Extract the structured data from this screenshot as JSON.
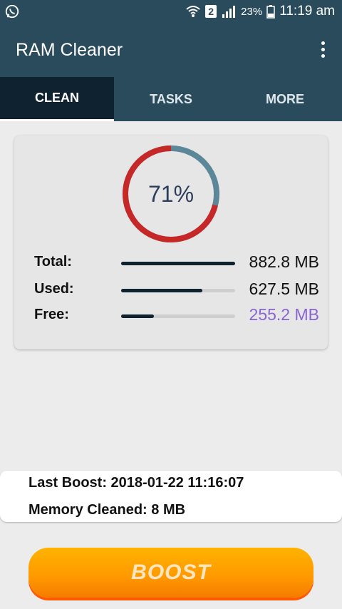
{
  "status_bar": {
    "sim_slot": "2",
    "battery": "23%",
    "time": "11:19 am",
    "icons": [
      "whatsapp-icon",
      "wifi-icon",
      "signal-icon",
      "battery-charging-icon"
    ]
  },
  "app_bar": {
    "title": "RAM Cleaner",
    "menu_icon": "overflow-menu-icon"
  },
  "tabs": [
    {
      "label": "CLEAN",
      "active": true
    },
    {
      "label": "TASKS",
      "active": false
    },
    {
      "label": "MORE",
      "active": false
    }
  ],
  "memory": {
    "usage_percent_label": "71%",
    "usage_fraction": 0.71,
    "rows": [
      {
        "label": "Total:",
        "value": "882.8 MB",
        "fraction": 1.0
      },
      {
        "label": "Used:",
        "value": "627.5 MB",
        "fraction": 0.71
      },
      {
        "label": "Free:",
        "value": "255.2 MB",
        "fraction": 0.29
      }
    ],
    "colors": {
      "used_arc": "#c62828",
      "free_arc": "#5b8798",
      "free_value": "#8a63d2"
    }
  },
  "info": {
    "last_boost": "Last Boost: 2018-01-22 11:16:07",
    "memory_cleaned": "Memory Cleaned: 8 MB"
  },
  "boost_button": {
    "label": "BOOST"
  },
  "theme": {
    "primary": "#2a4b5c",
    "tab_active": "#0f2230",
    "accent": "#ff9800"
  }
}
